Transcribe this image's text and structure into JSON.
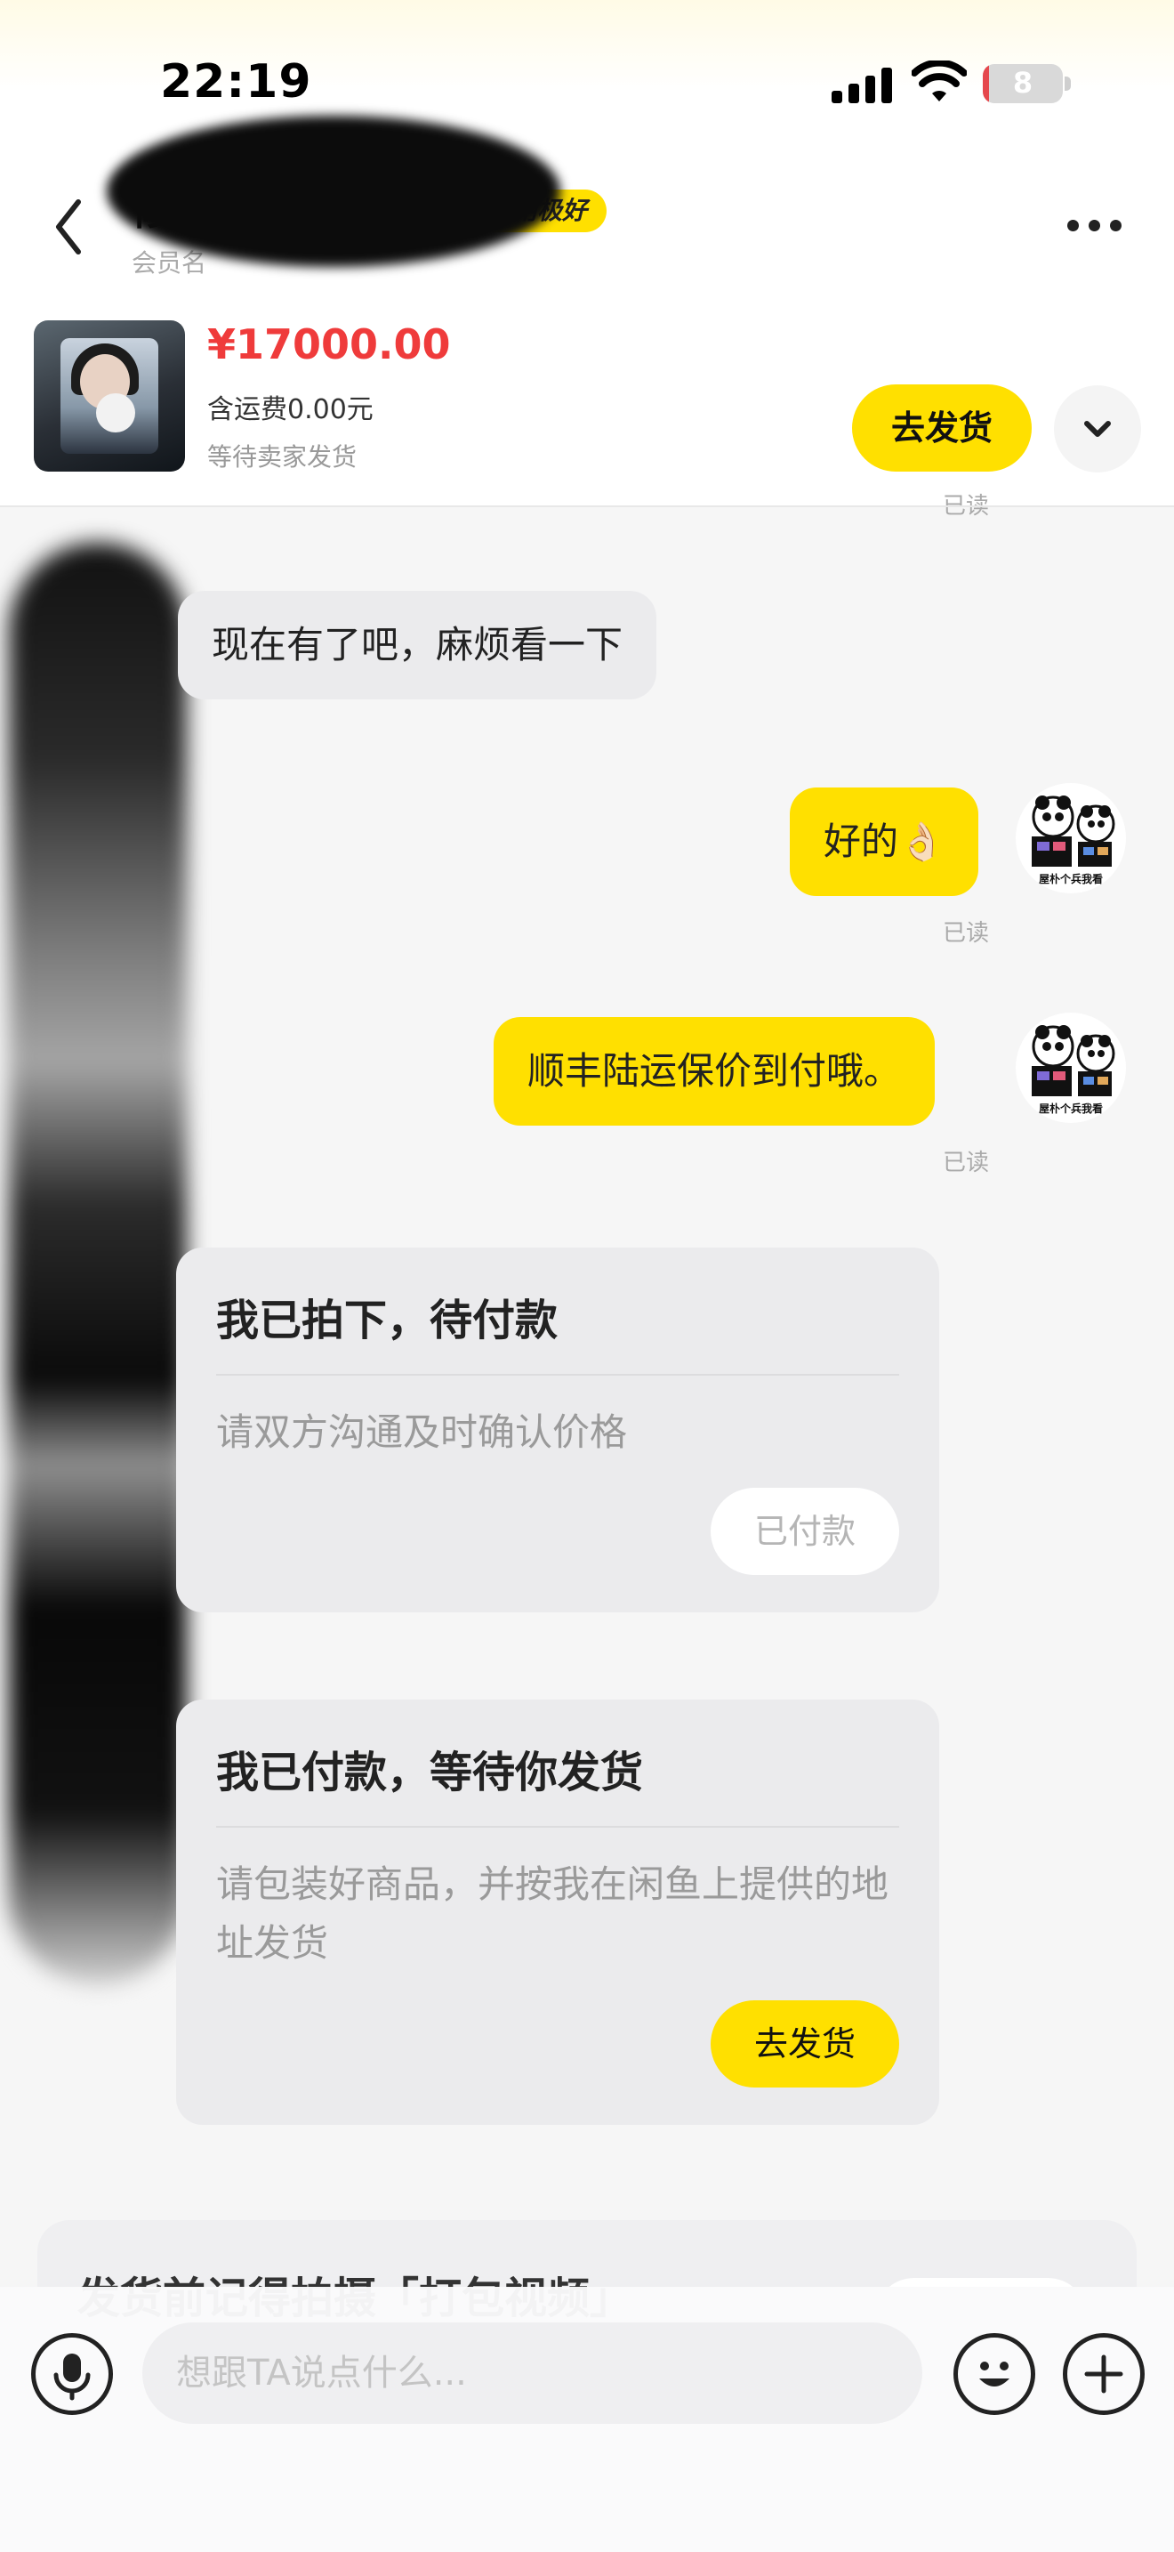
{
  "status_bar": {
    "time": "22:19",
    "battery": "8",
    "battery_fraction": 0.08
  },
  "header": {
    "title": "修",
    "badge": "卖家信用极好",
    "subtitle": "会员名"
  },
  "product": {
    "price": "¥17000.00",
    "shipping_fee": "含运费0.00元",
    "status": "等待卖家发货",
    "ship_button": "去发货"
  },
  "messages": {
    "read_label": "已读",
    "m1": "现在有了吧，麻烦看一下",
    "m2": "好的👌🏻",
    "m3": "顺丰陆运保价到付哦。",
    "sticker_caption": "屋朴个兵我看"
  },
  "cards": {
    "c1": {
      "title": "我已拍下，待付款",
      "body": "请双方沟通及时确认价格",
      "button": "已付款"
    },
    "c2": {
      "title": "我已付款，等待你发货",
      "body": "请包装好商品，并按我在闲鱼上提供的地址发货",
      "button": "去发货"
    }
  },
  "tip": {
    "text": "发货前记得拍摄「打包视频」"
  },
  "input": {
    "placeholder": "想跟TA说点什么..."
  },
  "colors": {
    "accent": "#ffe000",
    "price": "#ef3b3b",
    "bubble_left": "#ebebed"
  }
}
